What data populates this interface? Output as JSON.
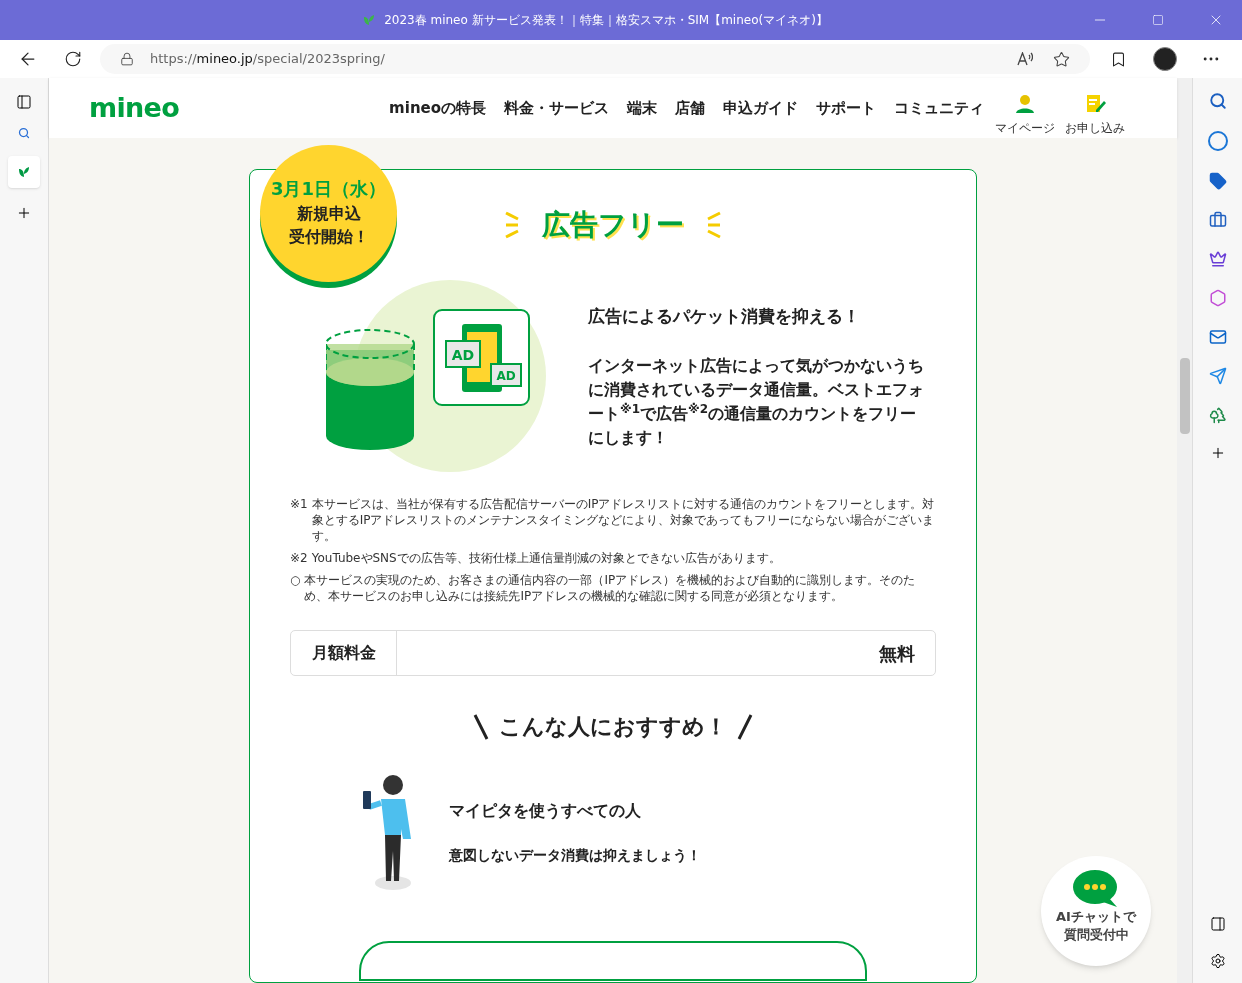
{
  "window": {
    "title": "2023春 mineo 新サービス発表！｜特集｜格安スマホ・SIM【mineo(マイネオ)】"
  },
  "address_bar": {
    "url_prefix": "https://",
    "url_host": "mineo.jp",
    "url_path": "/special/2023spring/"
  },
  "site_header": {
    "logo": "mineo",
    "nav": [
      "mineoの特長",
      "料金・サービス",
      "端末",
      "店舗",
      "申込ガイド",
      "サポート",
      "コミュニティ"
    ],
    "actions": [
      {
        "kind": "person",
        "label": "マイページ"
      },
      {
        "kind": "form",
        "label": "お申し込み"
      }
    ]
  },
  "badge": {
    "date": "3月1日（水）",
    "lines": [
      "新規申込",
      "受付開始！"
    ]
  },
  "section": {
    "title": "広告フリー",
    "headline": "広告によるパケット消費を抑える！",
    "body": "インターネット広告によって気がつかないうちに消費されているデータ通信量。ベストエフォート$^{※1}$で広告$^{※2}$の通信量のカウントをフリーにします！",
    "illustration_labels": [
      "AD",
      "AD"
    ],
    "notes": [
      {
        "mark": "※1",
        "text": "本サービスは、当社が保有する広告配信サーバーのIPアドレスリストに対する通信のカウントをフリーとします。対象とするIPアドレスリストのメンテナンスタイミングなどにより、対象であってもフリーにならない場合がございます。"
      },
      {
        "mark": "※2",
        "text": "YouTubeやSNSでの広告等、技術仕様上通信量削減の対象とできない広告があります。"
      },
      {
        "mark": "○",
        "text": "本サービスの実現のため、お客さまの通信内容の一部（IPアドレス）を機械的および自動的に識別します。そのため、本サービスのお申し込みには接続先IPアドレスの機械的な確認に関する同意が必須となります。"
      }
    ],
    "price": {
      "label": "月額料金",
      "value": "無料"
    },
    "recommend_title": "こんな人におすすめ！",
    "recommend": {
      "title": "マイピタを使うすべての人",
      "text": "意図しないデータ消費は抑えましょう！"
    }
  },
  "chat": {
    "lines": [
      "AIチャットで",
      "質問受付中"
    ]
  }
}
